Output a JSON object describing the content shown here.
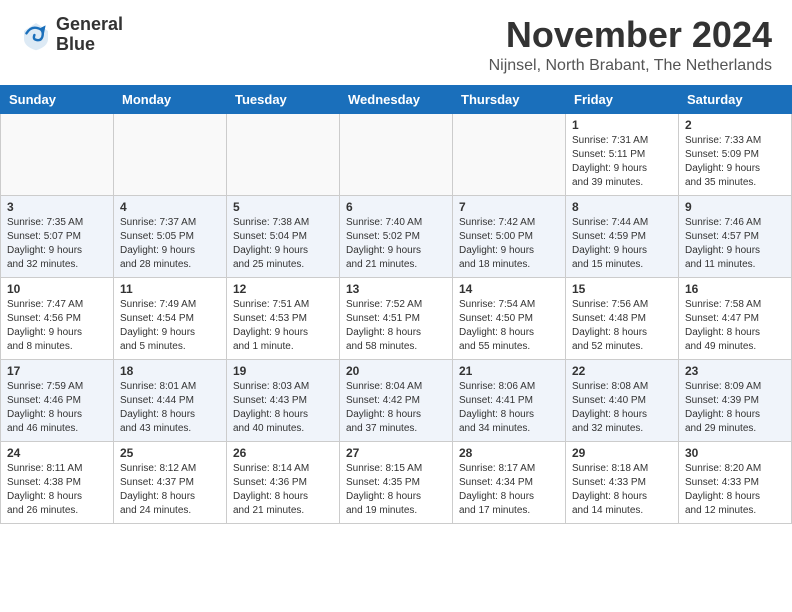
{
  "header": {
    "logo": {
      "general": "General",
      "blue": "Blue"
    },
    "title": "November 2024",
    "location": "Nijnsel, North Brabant, The Netherlands"
  },
  "weekdays": [
    "Sunday",
    "Monday",
    "Tuesday",
    "Wednesday",
    "Thursday",
    "Friday",
    "Saturday"
  ],
  "weeks": [
    [
      {
        "day": "",
        "info": ""
      },
      {
        "day": "",
        "info": ""
      },
      {
        "day": "",
        "info": ""
      },
      {
        "day": "",
        "info": ""
      },
      {
        "day": "",
        "info": ""
      },
      {
        "day": "1",
        "info": "Sunrise: 7:31 AM\nSunset: 5:11 PM\nDaylight: 9 hours\nand 39 minutes."
      },
      {
        "day": "2",
        "info": "Sunrise: 7:33 AM\nSunset: 5:09 PM\nDaylight: 9 hours\nand 35 minutes."
      }
    ],
    [
      {
        "day": "3",
        "info": "Sunrise: 7:35 AM\nSunset: 5:07 PM\nDaylight: 9 hours\nand 32 minutes."
      },
      {
        "day": "4",
        "info": "Sunrise: 7:37 AM\nSunset: 5:05 PM\nDaylight: 9 hours\nand 28 minutes."
      },
      {
        "day": "5",
        "info": "Sunrise: 7:38 AM\nSunset: 5:04 PM\nDaylight: 9 hours\nand 25 minutes."
      },
      {
        "day": "6",
        "info": "Sunrise: 7:40 AM\nSunset: 5:02 PM\nDaylight: 9 hours\nand 21 minutes."
      },
      {
        "day": "7",
        "info": "Sunrise: 7:42 AM\nSunset: 5:00 PM\nDaylight: 9 hours\nand 18 minutes."
      },
      {
        "day": "8",
        "info": "Sunrise: 7:44 AM\nSunset: 4:59 PM\nDaylight: 9 hours\nand 15 minutes."
      },
      {
        "day": "9",
        "info": "Sunrise: 7:46 AM\nSunset: 4:57 PM\nDaylight: 9 hours\nand 11 minutes."
      }
    ],
    [
      {
        "day": "10",
        "info": "Sunrise: 7:47 AM\nSunset: 4:56 PM\nDaylight: 9 hours\nand 8 minutes."
      },
      {
        "day": "11",
        "info": "Sunrise: 7:49 AM\nSunset: 4:54 PM\nDaylight: 9 hours\nand 5 minutes."
      },
      {
        "day": "12",
        "info": "Sunrise: 7:51 AM\nSunset: 4:53 PM\nDaylight: 9 hours\nand 1 minute."
      },
      {
        "day": "13",
        "info": "Sunrise: 7:52 AM\nSunset: 4:51 PM\nDaylight: 8 hours\nand 58 minutes."
      },
      {
        "day": "14",
        "info": "Sunrise: 7:54 AM\nSunset: 4:50 PM\nDaylight: 8 hours\nand 55 minutes."
      },
      {
        "day": "15",
        "info": "Sunrise: 7:56 AM\nSunset: 4:48 PM\nDaylight: 8 hours\nand 52 minutes."
      },
      {
        "day": "16",
        "info": "Sunrise: 7:58 AM\nSunset: 4:47 PM\nDaylight: 8 hours\nand 49 minutes."
      }
    ],
    [
      {
        "day": "17",
        "info": "Sunrise: 7:59 AM\nSunset: 4:46 PM\nDaylight: 8 hours\nand 46 minutes."
      },
      {
        "day": "18",
        "info": "Sunrise: 8:01 AM\nSunset: 4:44 PM\nDaylight: 8 hours\nand 43 minutes."
      },
      {
        "day": "19",
        "info": "Sunrise: 8:03 AM\nSunset: 4:43 PM\nDaylight: 8 hours\nand 40 minutes."
      },
      {
        "day": "20",
        "info": "Sunrise: 8:04 AM\nSunset: 4:42 PM\nDaylight: 8 hours\nand 37 minutes."
      },
      {
        "day": "21",
        "info": "Sunrise: 8:06 AM\nSunset: 4:41 PM\nDaylight: 8 hours\nand 34 minutes."
      },
      {
        "day": "22",
        "info": "Sunrise: 8:08 AM\nSunset: 4:40 PM\nDaylight: 8 hours\nand 32 minutes."
      },
      {
        "day": "23",
        "info": "Sunrise: 8:09 AM\nSunset: 4:39 PM\nDaylight: 8 hours\nand 29 minutes."
      }
    ],
    [
      {
        "day": "24",
        "info": "Sunrise: 8:11 AM\nSunset: 4:38 PM\nDaylight: 8 hours\nand 26 minutes."
      },
      {
        "day": "25",
        "info": "Sunrise: 8:12 AM\nSunset: 4:37 PM\nDaylight: 8 hours\nand 24 minutes."
      },
      {
        "day": "26",
        "info": "Sunrise: 8:14 AM\nSunset: 4:36 PM\nDaylight: 8 hours\nand 21 minutes."
      },
      {
        "day": "27",
        "info": "Sunrise: 8:15 AM\nSunset: 4:35 PM\nDaylight: 8 hours\nand 19 minutes."
      },
      {
        "day": "28",
        "info": "Sunrise: 8:17 AM\nSunset: 4:34 PM\nDaylight: 8 hours\nand 17 minutes."
      },
      {
        "day": "29",
        "info": "Sunrise: 8:18 AM\nSunset: 4:33 PM\nDaylight: 8 hours\nand 14 minutes."
      },
      {
        "day": "30",
        "info": "Sunrise: 8:20 AM\nSunset: 4:33 PM\nDaylight: 8 hours\nand 12 minutes."
      }
    ]
  ]
}
